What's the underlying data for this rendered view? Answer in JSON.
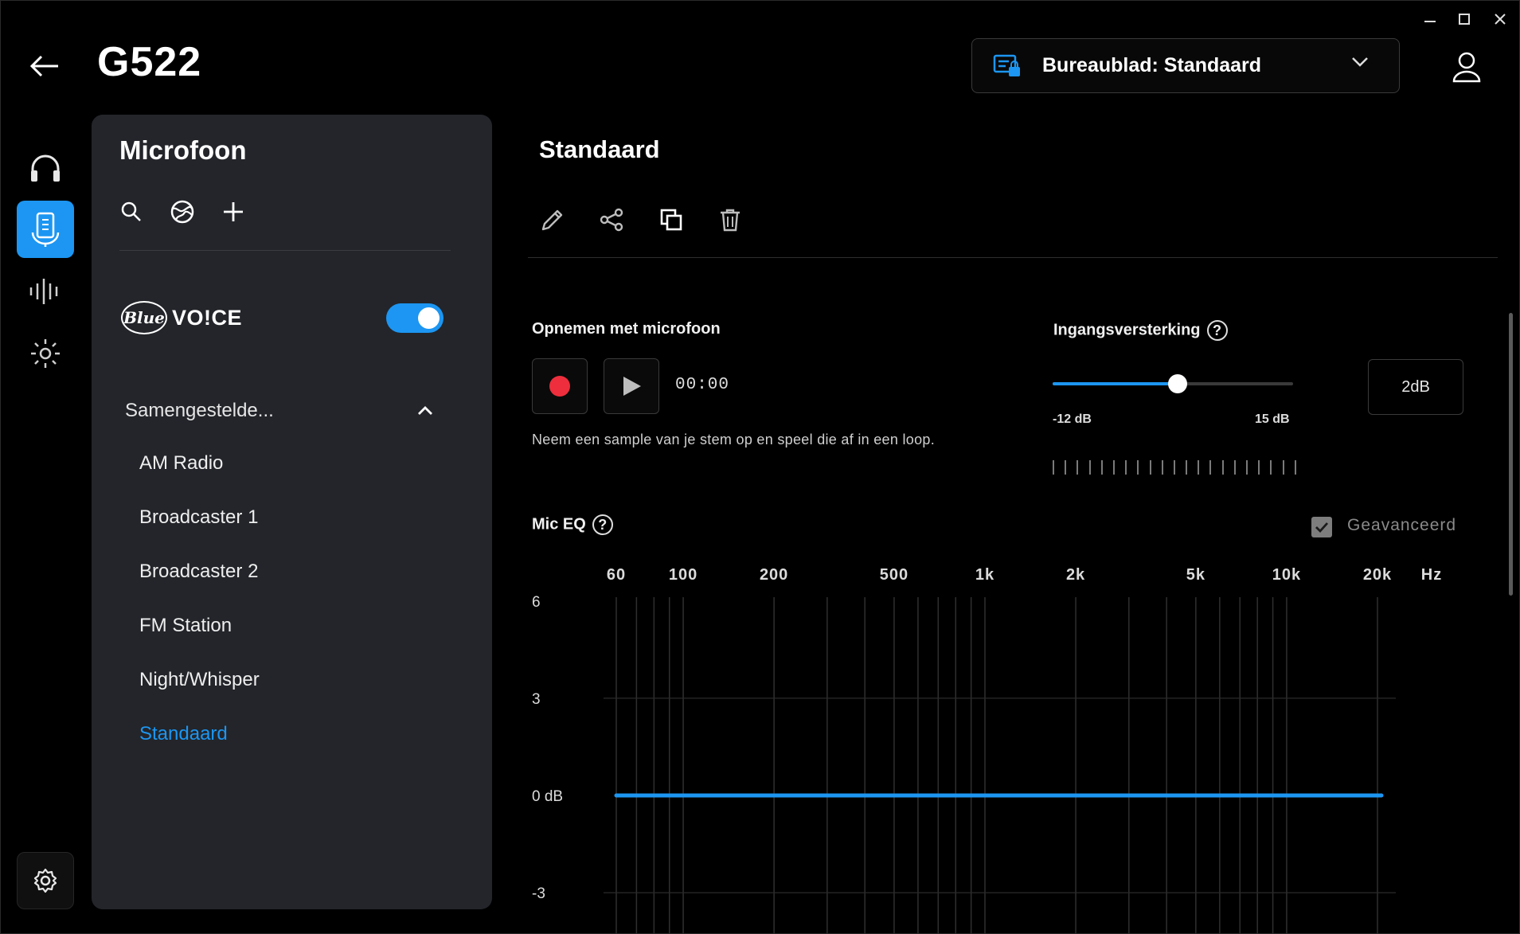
{
  "window": {
    "controls": {
      "minimize": "–",
      "maximize": "☐",
      "close": "✕"
    }
  },
  "header": {
    "device_name": "G522",
    "profile_label": "Bureaublad: Standaard"
  },
  "rail": {
    "items": [
      "headphones-icon",
      "microphone-icon",
      "equalizer-icon",
      "lighting-icon"
    ],
    "active": "microphone-icon"
  },
  "presets": {
    "title": "Microfoon",
    "bluevoice": {
      "logo_text": "Blue",
      "label": "VO!CE",
      "enabled": true
    },
    "group_label": "Samengestelde...",
    "items": [
      "AM Radio",
      "Broadcaster 1",
      "Broadcaster 2",
      "FM Station",
      "Night/Whisper",
      "Standaard"
    ],
    "selected": "Standaard"
  },
  "content": {
    "title": "Standaard",
    "record": {
      "label": "Opnemen met microfoon",
      "timer": "00:00",
      "hint": "Neem een sample van je stem op en speel die af in een loop."
    },
    "gain": {
      "label": "Ingangsversterking",
      "help": "?",
      "min_label": "-12 dB",
      "max_label": "15 dB",
      "min": -12,
      "max": 15,
      "value": 2,
      "value_label": "2dB"
    },
    "eq": {
      "label": "Mic EQ",
      "help": "?",
      "advanced_label": "Geavanceerd",
      "advanced_checked": true,
      "freq_labels": [
        "60",
        "100",
        "200",
        "500",
        "1k",
        "2k",
        "5k",
        "10k",
        "20k",
        "Hz"
      ],
      "db_labels": [
        "6",
        "3",
        "0 dB",
        "-3"
      ]
    }
  },
  "colors": {
    "accent": "#1c96f2",
    "record": "#ee2e3c",
    "panel": "#23252a"
  }
}
